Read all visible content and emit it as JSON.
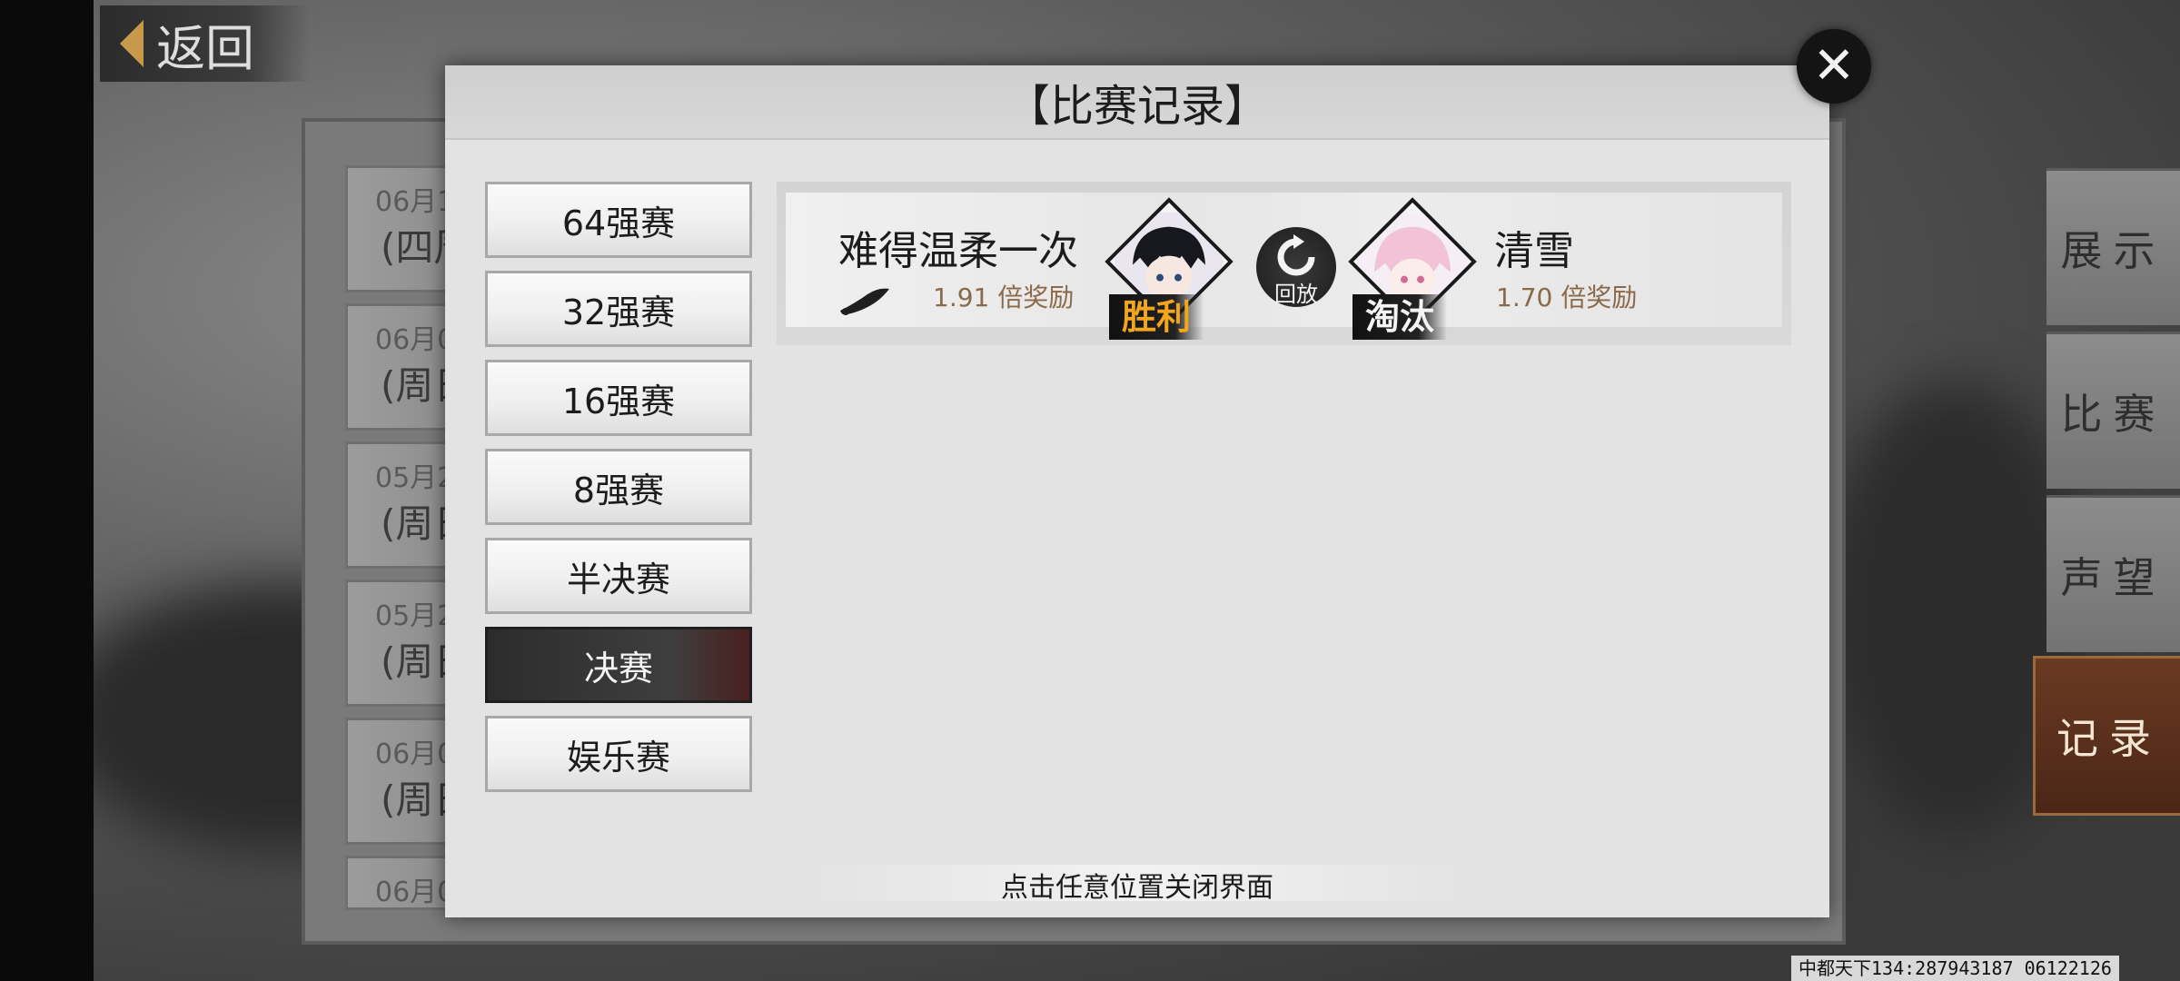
{
  "back": {
    "label": "返回"
  },
  "background_dates": [
    {
      "date": "06月1",
      "weekday": "(四周"
    },
    {
      "date": "06月0",
      "weekday": "(周日"
    },
    {
      "date": "05月2",
      "weekday": "(周日"
    },
    {
      "date": "05月2",
      "weekday": "(周日"
    },
    {
      "date": "06月0",
      "weekday": "(周日"
    },
    {
      "date": "06月0",
      "weekday": ""
    }
  ],
  "right_tabs": [
    {
      "label": "展示",
      "active": false
    },
    {
      "label": "比赛",
      "active": false
    },
    {
      "label": "声望",
      "active": false
    },
    {
      "label": "记录",
      "active": true
    }
  ],
  "dialog": {
    "title": "【比赛记录】",
    "close_icon": "close-x-icon",
    "categories": [
      {
        "label": "64强赛",
        "active": false
      },
      {
        "label": "32强赛",
        "active": false
      },
      {
        "label": "16强赛",
        "active": false
      },
      {
        "label": "8强赛",
        "active": false
      },
      {
        "label": "半决赛",
        "active": false
      },
      {
        "label": "决赛",
        "active": true
      },
      {
        "label": "娱乐赛",
        "active": false
      }
    ],
    "match": {
      "left": {
        "name": "难得温柔一次",
        "reward": "1.91 倍奖励",
        "result": "胜利",
        "icon": "horn-icon"
      },
      "right": {
        "name": "清雪",
        "reward": "1.70 倍奖励",
        "result": "淘汰"
      },
      "replay_label": "回放"
    },
    "footer_hint": "点击任意位置关闭界面"
  },
  "watermark": "中都天下134:287943187 06122126",
  "colors": {
    "win": "#f2a61d",
    "lose": "#f4f4f4",
    "reward": "#8a6a48",
    "active_tab": "#4b2617"
  }
}
